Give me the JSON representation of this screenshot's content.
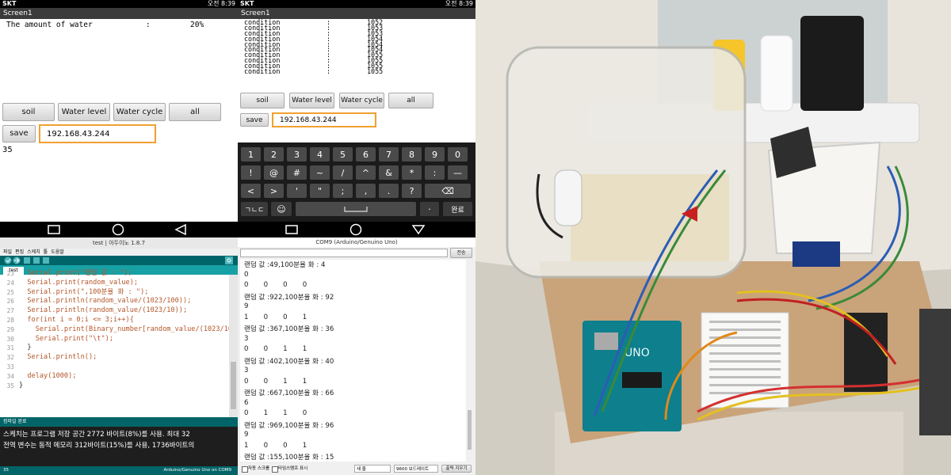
{
  "phone1": {
    "status_carrier": "SKT",
    "status_right": "오전 8:39",
    "screen_title": "Screen1",
    "water_label": "The amount of water",
    "water_sep": ":",
    "water_value": "20%",
    "buttons": [
      "soil",
      "Water level",
      "Water cycle",
      "all"
    ],
    "save_label": "save",
    "ip_value": "192.168.43.244",
    "reading": "35"
  },
  "phone2": {
    "status_carrier": "SKT",
    "status_right": "오전 8:39",
    "screen_title": "Screen1",
    "conditions": [
      {
        "label": "condition",
        "sep": ":",
        "value": "1052"
      },
      {
        "label": "condition",
        "sep": ":",
        "value": "1053"
      },
      {
        "label": "condition",
        "sep": ":",
        "value": "1053"
      },
      {
        "label": "condition",
        "sep": ":",
        "value": "1054"
      },
      {
        "label": "condition",
        "sep": ":",
        "value": "1054"
      },
      {
        "label": "condition",
        "sep": ":",
        "value": "1054"
      },
      {
        "label": "condition",
        "sep": ":",
        "value": "1055"
      },
      {
        "label": "condition",
        "sep": ":",
        "value": "1055"
      },
      {
        "label": "condition",
        "sep": ":",
        "value": "1055"
      },
      {
        "label": "condition",
        "sep": ":",
        "value": "1055"
      }
    ],
    "buttons": [
      "soil",
      "Water level",
      "Water cycle",
      "all"
    ],
    "save_label": "save",
    "ip_value": "192.168.43.244",
    "keyboard": {
      "row1": [
        "1",
        "2",
        "3",
        "4",
        "5",
        "6",
        "7",
        "8",
        "9",
        "0"
      ],
      "row2": [
        "!",
        "@",
        "#",
        "~",
        "/",
        "^",
        "&",
        "*",
        ":",
        "—"
      ],
      "row3": [
        "<",
        ">",
        "'",
        "\"",
        ";",
        ",",
        ".",
        "?",
        "⌫"
      ],
      "row4": [
        "ㄱㄴㄷ",
        "☺",
        "",
        "·",
        "완료"
      ]
    }
  },
  "ide": {
    "window_title": "test | 아두이노 1.8.7",
    "menu": [
      "파일",
      "편집",
      "스케치",
      "툴",
      "도움말"
    ],
    "tab": "test",
    "line_numbers": [
      "23",
      "24",
      "25",
      "26",
      "27",
      "28",
      "29",
      "30",
      "31",
      "32",
      "33",
      "34",
      "35"
    ],
    "code_lines": [
      "  Serial.print(\"랜덤 값 : \");",
      "  Serial.print(random_value);",
      "  Serial.print(\",100분율 화 : \");",
      "  Serial.println(random_value/(1023/100));",
      "  Serial.println(random_value/(1023/10));",
      "  for(int i = 0;i <= 3;i++){",
      "    Serial.print(Binary_number[random_value/(1023/10)][",
      "    Serial.print(\"\\t\");",
      "  }",
      "  Serial.println();",
      "",
      "  delay(1000);",
      "}"
    ],
    "console_header": "컴파일 완료",
    "console_lines": [
      "스케치는 프로그램 저장 공간 2772 바이트(8%)를 사용. 최대 32",
      "전역 변수는 동적 메모리 312바이트(15%)를 사용, 1736바이트의"
    ],
    "status_left": "35",
    "status_right": "Arduino/Genuino Uno on COM9"
  },
  "serial": {
    "window_title": "COM9 (Arduino/Genuino Uno)",
    "send_label": "전송",
    "lines": [
      "랜덤 값 :49,100분율 화 : 4",
      "0",
      "0       0       0       0",
      "랜덤 값 :922,100분율 화 : 92",
      "9",
      "1       0       0       1",
      "랜덤 값 :367,100분율 화 : 36",
      "3",
      "0       0       1       1",
      "랜덤 값 :402,100분율 화 : 40",
      "3",
      "0       0       1       1",
      "랜덤 값 :667,100분율 화 : 66",
      "6",
      "0       1       1       0",
      "랜덤 값 :969,100분율 화 : 96",
      "9",
      "1       0       0       1",
      "랜덤 값 :155,100분율 화 : 15"
    ],
    "autoscroll_label": "자동 스크롤",
    "timestamp_label": "타임스탬프 표시",
    "line_ending": "새 줄",
    "baud": "9600 보드레이트",
    "clear_label": "출력 지우기"
  },
  "colors": {
    "accent_orange": "#f0a030",
    "ide_teal": "#17a1a5",
    "ide_dark": "#006468",
    "console_bg": "#1e1e1e"
  }
}
